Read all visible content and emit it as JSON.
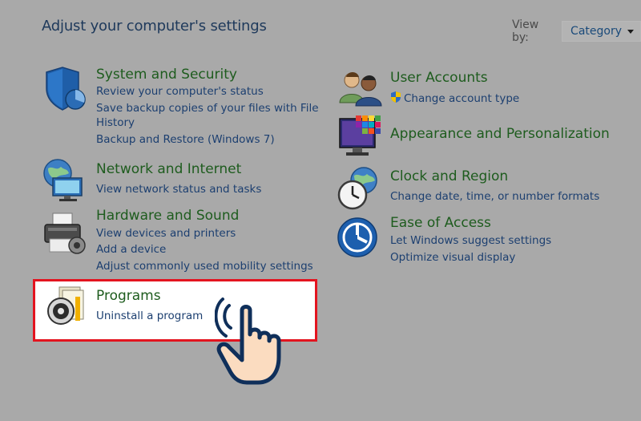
{
  "page_title": "Adjust your computer's settings",
  "view_by": {
    "label": "View by:",
    "value": "Category"
  },
  "categories": {
    "system": {
      "title": "System and Security",
      "icon": "shield-security-icon",
      "links": [
        "Review your computer's status",
        "Save backup copies of your files with File",
        "History",
        "Backup and Restore (Windows 7)"
      ]
    },
    "network": {
      "title": "Network and Internet",
      "icon": "network-globe-icon",
      "links": [
        "View network status and tasks"
      ]
    },
    "hardware": {
      "title": "Hardware and Sound",
      "icon": "printer-icon",
      "links": [
        "View devices and printers",
        "Add a device",
        "Adjust commonly used mobility settings"
      ]
    },
    "programs": {
      "title": "Programs",
      "icon": "programs-disc-icon",
      "links": [
        "Uninstall a program"
      ]
    },
    "users": {
      "title": "User Accounts",
      "icon": "users-icon",
      "links": [
        "Change account type"
      ]
    },
    "appearance": {
      "title": "Appearance and Personalization",
      "icon": "monitor-palette-icon",
      "links": []
    },
    "clock": {
      "title": "Clock and Region",
      "icon": "clock-globe-icon",
      "links": [
        "Change date, time, or number formats"
      ]
    },
    "ease": {
      "title": "Ease of Access",
      "icon": "ease-of-access-icon",
      "links": [
        "Let Windows suggest settings",
        "Optimize visual display"
      ]
    }
  },
  "colors": {
    "background": "#a9a9a9",
    "category_title": "#1e5c1e",
    "link": "#1c3f70",
    "highlight_border": "#e3141f"
  }
}
